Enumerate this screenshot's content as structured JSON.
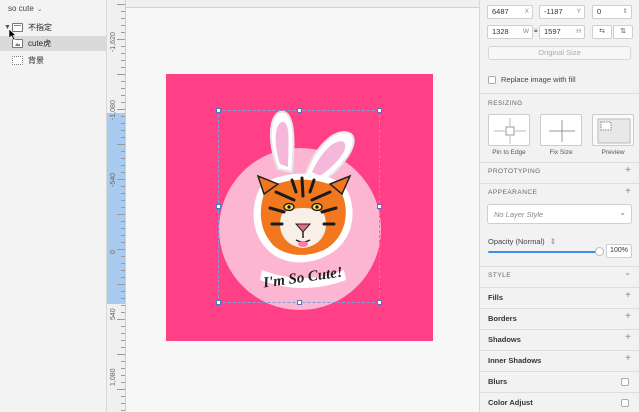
{
  "layers_panel": {
    "page_selector": "so cute",
    "layers": [
      {
        "name": "不指定",
        "type": "group",
        "expanded": true
      },
      {
        "name": "cute虎",
        "type": "image",
        "selected": true
      },
      {
        "name": "背景",
        "type": "background"
      }
    ]
  },
  "ruler": {
    "labels": [
      "-1,620",
      "-1,080",
      "-540",
      "0",
      "540",
      "1,080"
    ]
  },
  "canvas": {
    "artboard_color": "#ff3f86",
    "circle_color": "#fdb6d1",
    "sticker_text": "I'm So Cute!"
  },
  "inspector": {
    "x_value": "6487",
    "x_label": "X",
    "y_value": "-1187",
    "y_label": "Y",
    "rotation_value": "0",
    "w_value": "1328",
    "w_label": "W",
    "h_value": "1597",
    "h_label": "H",
    "original_size_label": "Original Size",
    "replace_image_label": "Replace image with fill",
    "resizing_header": "RESIZING",
    "pin_to_edge_label": "Pin to Edge",
    "fix_size_label": "Fix Size",
    "preview_label": "Preview",
    "prototyping_header": "PROTOTYPING",
    "appearance_header": "APPEARANCE",
    "layer_style_placeholder": "No Layer Style",
    "opacity_label": "Opacity (Normal)",
    "opacity_value": "100%",
    "opacity_fraction": 1.0,
    "style_header": "STYLE",
    "style_rows": [
      "Fills",
      "Borders",
      "Shadows",
      "Inner Shadows",
      "Blurs",
      "Color Adjust"
    ]
  }
}
